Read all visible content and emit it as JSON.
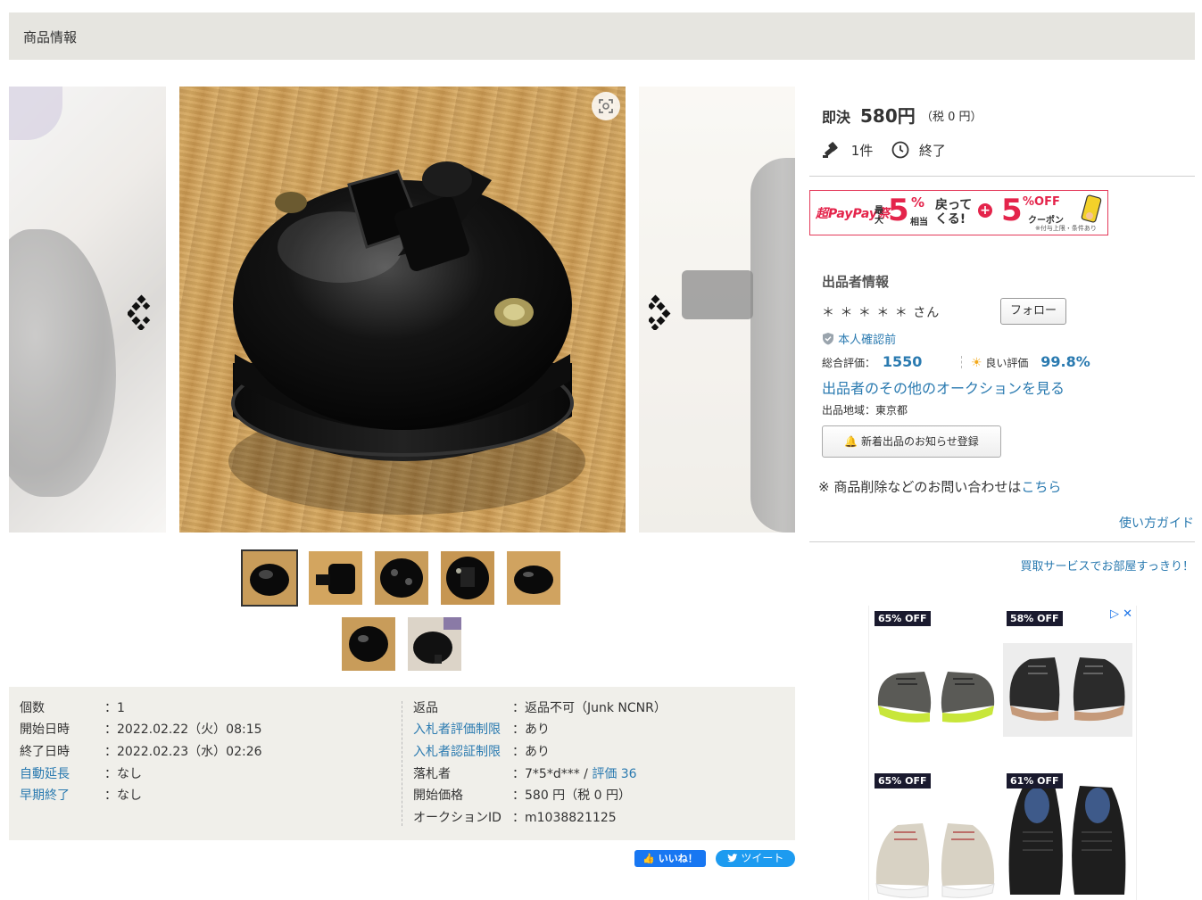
{
  "section_title": "商品情報",
  "gallery": {
    "prev_icon": "chevron-left-icon",
    "next_icon": "chevron-right-icon",
    "zoom_icon": "zoom-icon",
    "thumbnail_count": 7,
    "active_thumbnail": 1
  },
  "details": {
    "left": [
      {
        "label": "個数",
        "value": "：1",
        "link": false
      },
      {
        "label": "開始日時",
        "value": "：2022.02.22（火）08:15",
        "link": false
      },
      {
        "label": "終了日時",
        "value": "：2022.02.23（水）02:26",
        "link": false
      },
      {
        "label": "自動延長",
        "value": "：なし",
        "link": true
      },
      {
        "label": "早期終了",
        "value": "：なし",
        "link": true
      }
    ],
    "right": [
      {
        "label": "返品",
        "value": "：返品不可（Junk NCNR）",
        "link": false
      },
      {
        "label": "入札者評価制限",
        "value": "：あり",
        "link": true
      },
      {
        "label": "入札者認証制限",
        "value": "：あり",
        "link": true
      },
      {
        "label": "落札者",
        "value": "：7*5*d*** / ",
        "link": false,
        "extra_link": "評価 36"
      },
      {
        "label": "開始価格",
        "value": "：580 円（税 0 円）",
        "link": false
      },
      {
        "label": "オークションID",
        "value": "：m1038821125",
        "link": false
      }
    ]
  },
  "social": {
    "like": "いいね！",
    "tweet": "ツイート"
  },
  "price": {
    "label": "即決",
    "value": "580円",
    "tax": "（税 0 円）"
  },
  "bids": {
    "count": "1件",
    "status": "終了"
  },
  "promo": {
    "brand": "超PayPay祭",
    "prefix": "最大",
    "percent1": "5",
    "unit1": "%",
    "sub1": "相当",
    "text1": "戻ってくる!",
    "plus": "+",
    "percent2": "5",
    "off": "%OFF",
    "coupon": "クーポン",
    "note": "※付与上限・条件あり"
  },
  "seller": {
    "title": "出品者情報",
    "name": "＊ ＊ ＊ ＊ ＊ さん",
    "follow": "フォロー",
    "verify": "本人確認前",
    "total_label": "総合評価：",
    "total_value": "1550",
    "good_label": "良い評価",
    "good_value": "99.8%",
    "other_link": "出品者のその他のオークションを見る",
    "region": "出品地域：東京都",
    "notify": "新着出品のお知らせ登録"
  },
  "inquiry": {
    "prefix": "※ 商品削除などのお問い合わせは",
    "link": "こちら"
  },
  "guide": "使い方ガイド",
  "buyback": "買取サービスでお部屋すっきり！",
  "ad": {
    "items": [
      {
        "badge": "65% OFF",
        "color": "#5a5a56",
        "sole": "#c8e63a"
      },
      {
        "badge": "58% OFF",
        "color": "#2b2b2b",
        "sole": "#c59a7a"
      },
      {
        "badge": "65% OFF",
        "color": "#d8d2c4",
        "sole": "#ffffff"
      },
      {
        "badge": "61% OFF",
        "color": "#1e1e1e",
        "sole": "#1e1e1e"
      }
    ]
  }
}
